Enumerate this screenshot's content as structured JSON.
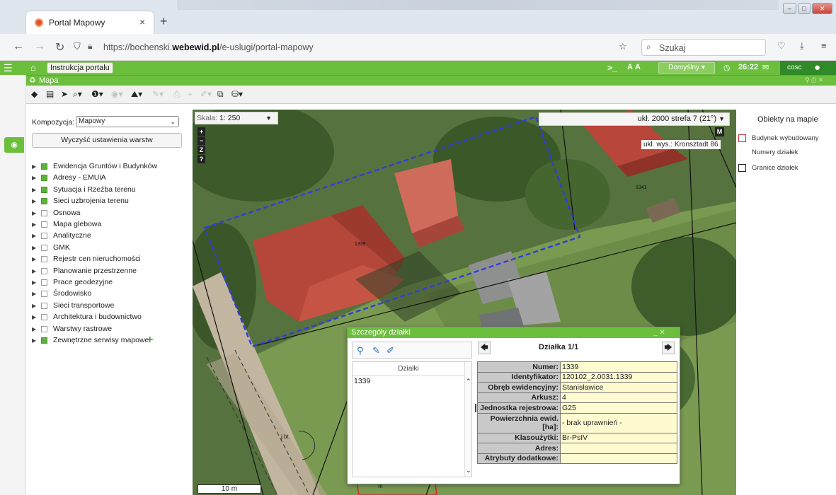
{
  "browser": {
    "tab_title": "Portal Mapowy",
    "url_prefix": "https://bochenski.",
    "url_domain": "webewid.pl",
    "url_path": "/e-uslugi/portal-mapowy",
    "search_placeholder": "Szukaj"
  },
  "header": {
    "instruction_button": "Instrukcja portalu",
    "profile_dropdown": "Domyślny ▾",
    "timer": "26:22",
    "user_label": "cosc"
  },
  "map_panel": {
    "title": "Mapa"
  },
  "layers_panel": {
    "composition_label": "Kompozycja:",
    "composition_value": "Mapowy",
    "clear_button": "Wyczyść ustawienia warstw",
    "layers": [
      {
        "label": "Ewidencja Gruntów i Budynków",
        "checked": true
      },
      {
        "label": "Adresy - EMUiA",
        "checked": true
      },
      {
        "label": "Sytuacja i Rzeźba terenu",
        "checked": true
      },
      {
        "label": "Sieci uzbrojenia terenu",
        "checked": true
      },
      {
        "label": "Osnowa",
        "checked": false
      },
      {
        "label": "Mapa glebowa",
        "checked": false
      },
      {
        "label": "Analityczne",
        "checked": false
      },
      {
        "label": "GMK",
        "checked": false
      },
      {
        "label": "Rejestr cen nieruchomości",
        "checked": false
      },
      {
        "label": "Planowanie przestrzenne",
        "checked": false
      },
      {
        "label": "Prace geodezyjne",
        "checked": false
      },
      {
        "label": "Środowisko",
        "checked": false
      },
      {
        "label": "Sieci transportowe",
        "checked": false
      },
      {
        "label": "Architektura i budownictwo",
        "checked": false
      },
      {
        "label": "Warstwy rastrowe",
        "checked": false
      },
      {
        "label": "Zewnętrzne serwisy mapowe",
        "checked": false
      }
    ]
  },
  "map": {
    "scale_prefix": "Skala:",
    "scale_value": "1: 250",
    "crs": "ukł. 2000 strefa 7 (21°)",
    "height_system": "ukł. wys.: Kronsztadt 86",
    "scale_bar": "10 m",
    "parcel_labels": {
      "main": "1339",
      "neighbor": "1341",
      "road": "j.bt.",
      "bottom": "m"
    },
    "zoom_buttons": [
      "+",
      "−",
      "Z",
      "?"
    ],
    "m_button": "M"
  },
  "legend": {
    "title": "Obiekty na mapie",
    "items": [
      {
        "label": "Budynek wybudowany",
        "box": "red"
      },
      {
        "label": "Numery działek",
        "box": "none"
      },
      {
        "label": "Granice działek",
        "box": "black"
      }
    ]
  },
  "popup": {
    "title": "Szczegóły działki",
    "list_header": "Działki",
    "list_items": [
      "1339"
    ],
    "plot_title": "Działka 1/1",
    "attributes": [
      {
        "key": "Numer:",
        "value": "1339"
      },
      {
        "key": "Identyfikator:",
        "value": "120102_2.0031.1339"
      },
      {
        "key": "Obręb ewidencyjny:",
        "value": "Stanisławice"
      },
      {
        "key": "Arkusz:",
        "value": "4"
      },
      {
        "key": "Jednostka rejestrowa:",
        "value": "G25"
      },
      {
        "key": "Powierzchnia ewid. [ha]:",
        "value": "- brak uprawnień -"
      },
      {
        "key": "Klasoużytki:",
        "value": "Br-PsIV"
      },
      {
        "key": "Adres:",
        "value": ""
      },
      {
        "key": "Atrybuty dodatkowe:",
        "value": ""
      }
    ]
  },
  "colors": {
    "accent_green": "#6cbf3d",
    "parcel_boundary": "#2f3fd8",
    "roof_red": "#b5473a"
  }
}
